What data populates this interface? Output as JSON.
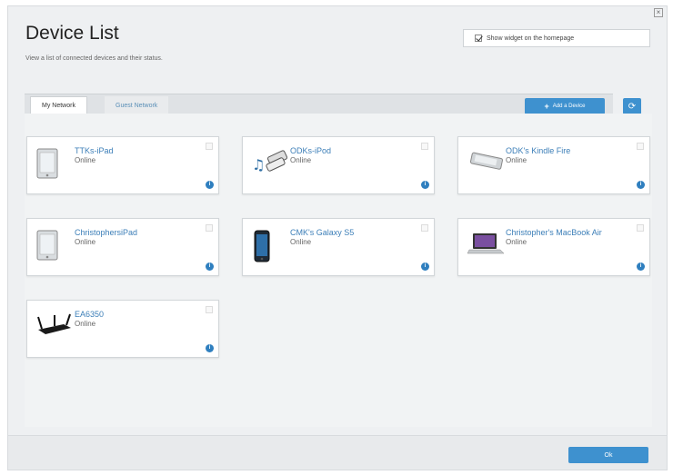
{
  "header": {
    "title": "Device List",
    "subtitle": "View a list of connected devices and their status.",
    "widget_label": "Show widget on the homepage"
  },
  "tabs": [
    {
      "label": "My Network",
      "active": true
    },
    {
      "label": "Guest Network",
      "active": false
    }
  ],
  "toolbar": {
    "add_device_label": "Add a Device",
    "refresh_icon": "refresh-icon"
  },
  "devices": [
    {
      "name": "TTKs-iPad",
      "status": "Online",
      "icon": "tablet-icon"
    },
    {
      "name": "ODKs-iPod",
      "status": "Online",
      "icon": "media-player-icon"
    },
    {
      "name": "ODK's Kindle Fire",
      "status": "Online",
      "icon": "kindle-icon"
    },
    {
      "name": "ChristophersiPad",
      "status": "Online",
      "icon": "tablet-icon"
    },
    {
      "name": "CMK's Galaxy S5",
      "status": "Online",
      "icon": "smartphone-icon"
    },
    {
      "name": "Christopher's MacBook Air",
      "status": "Online",
      "icon": "laptop-icon"
    },
    {
      "name": "EA6350",
      "status": "Online",
      "icon": "router-icon"
    }
  ],
  "footer": {
    "ok_label": "Ok"
  },
  "colors": {
    "accent": "#3e91cf",
    "link": "#3d7fb8"
  }
}
